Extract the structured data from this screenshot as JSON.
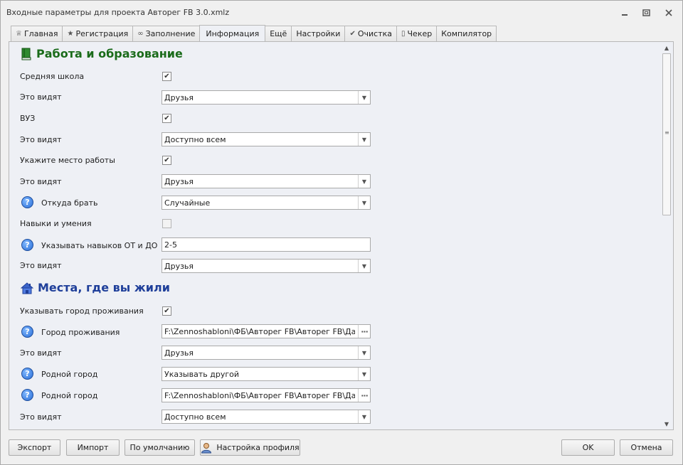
{
  "window": {
    "title": "Входные параметры для проекта Авторег FB 3.0.xmlz"
  },
  "tabs": [
    {
      "label": "Главная",
      "icon": "home-icon",
      "glyph": "♕"
    },
    {
      "label": "Регистрация",
      "icon": "star-icon",
      "glyph": "★"
    },
    {
      "label": "Заполнение",
      "icon": "infinity-icon",
      "glyph": "∞"
    },
    {
      "label": "Информация",
      "icon": "",
      "glyph": "",
      "active": true
    },
    {
      "label": "Ещё",
      "icon": "",
      "glyph": ""
    },
    {
      "label": "Настройки",
      "icon": "",
      "glyph": ""
    },
    {
      "label": "Очистка",
      "icon": "check-icon",
      "glyph": "✔"
    },
    {
      "label": "Чекер",
      "icon": "phone-icon",
      "glyph": "▯"
    },
    {
      "label": "Компилятор",
      "icon": "",
      "glyph": ""
    }
  ],
  "sections": {
    "work": {
      "title": "Работа и образование",
      "icon": "book-icon"
    },
    "places": {
      "title": "Места, где вы жили",
      "icon": "house-icon"
    }
  },
  "fields": {
    "school_label": "Средняя школа",
    "school_checked": true,
    "school_vis_label": "Это видят",
    "school_vis_value": "Друзья",
    "uni_label": "ВУЗ",
    "uni_checked": true,
    "uni_vis_label": "Это видят",
    "uni_vis_value": "Доступно всем",
    "work_label": "Укажите место работы",
    "work_checked": true,
    "work_vis_label": "Это видят",
    "work_vis_value": "Друзья",
    "source_label": "Откуда брать",
    "source_value": "Случайные",
    "skills_label": "Навыки и умения",
    "skills_checked": false,
    "skills_range_label": "Указывать навыков ОТ и ДО",
    "skills_range_value": "2-5",
    "skills_vis_label": "Это видят",
    "skills_vis_value": "Друзья",
    "city_flag_label": "Указывать город проживания",
    "city_flag_checked": true,
    "city_label": "Город проживания",
    "city_value": "F:\\Zennoshabloni\\ФБ\\Авторег FB\\Авторег FB\\Данные",
    "city_vis_label": "Это видят",
    "city_vis_value": "Друзья",
    "home_mode_label": "Родной город",
    "home_mode_value": "Указывать другой",
    "home_path_label": "Родной город",
    "home_path_value": "F:\\Zennoshabloni\\ФБ\\Авторег FB\\Авторег FB\\Данные",
    "home_vis_label": "Это видят",
    "home_vis_value": "Доступно всем"
  },
  "help_glyph": "?",
  "dots_glyph": "···",
  "footer": {
    "export": "Экспорт",
    "import": "Импорт",
    "default": "По умолчанию",
    "profile": "Настройка профиля",
    "ok": "OK",
    "cancel": "Отмена"
  },
  "colors": {
    "section_green": "#1a6b1a",
    "section_blue": "#1f3f9a",
    "help_blue": "#2a6dd6"
  }
}
